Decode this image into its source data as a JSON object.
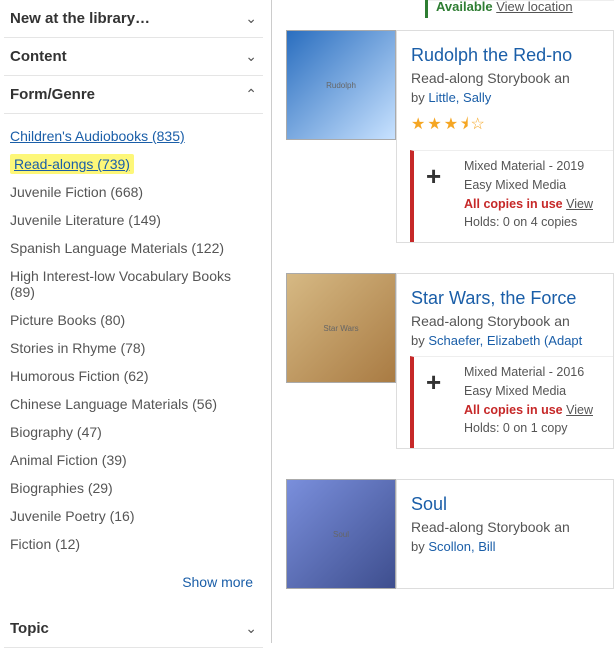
{
  "filters": [
    {
      "label": "New at the library…",
      "expanded": false
    },
    {
      "label": "Content",
      "expanded": false
    },
    {
      "label": "Form/Genre",
      "expanded": true
    },
    {
      "label": "Topic",
      "expanded": false
    }
  ],
  "formGenre": [
    {
      "label": "Children's Audiobooks (835)",
      "link": true,
      "hl": false
    },
    {
      "label": "Read-alongs (739)",
      "link": true,
      "hl": true
    },
    {
      "label": "Juvenile Fiction (668)",
      "link": false,
      "hl": false
    },
    {
      "label": "Juvenile Literature (149)",
      "link": false,
      "hl": false
    },
    {
      "label": "Spanish Language Materials (122)",
      "link": false,
      "hl": false
    },
    {
      "label": "High Interest-low Vocabulary Books (89)",
      "link": false,
      "hl": false
    },
    {
      "label": "Picture Books (80)",
      "link": false,
      "hl": false
    },
    {
      "label": "Stories in Rhyme (78)",
      "link": false,
      "hl": false
    },
    {
      "label": "Humorous Fiction (62)",
      "link": false,
      "hl": false
    },
    {
      "label": "Chinese Language Materials (56)",
      "link": false,
      "hl": false
    },
    {
      "label": "Biography (47)",
      "link": false,
      "hl": false
    },
    {
      "label": "Animal Fiction (39)",
      "link": false,
      "hl": false
    },
    {
      "label": "Biographies (29)",
      "link": false,
      "hl": false
    },
    {
      "label": "Juvenile Poetry (16)",
      "link": false,
      "hl": false
    },
    {
      "label": "Fiction (12)",
      "link": false,
      "hl": false
    }
  ],
  "showMore": "Show more",
  "topAvail": {
    "status": "Available",
    "loc": "View location"
  },
  "results": [
    {
      "title": "Rudolph the Red-no",
      "subtitle": "Read-along Storybook an",
      "byLabel": "by ",
      "author": "Little, Sally",
      "stars": "★★★⯨☆",
      "format": "Mixed Material - 2019",
      "media": "Easy Mixed Media",
      "status": "All copies in use",
      "view": "View",
      "holds": "Holds: 0 on 4 copies"
    },
    {
      "title": "Star Wars, the Force",
      "subtitle": "Read-along Storybook an",
      "byLabel": "by ",
      "author": "Schaefer, Elizabeth (Adapt",
      "format": "Mixed Material - 2016",
      "media": "Easy Mixed Media",
      "status": "All copies in use",
      "view": "View",
      "holds": "Holds: 0 on 1 copy"
    },
    {
      "title": "Soul",
      "subtitle": "Read-along Storybook an",
      "byLabel": "by ",
      "author": "Scollon, Bill"
    }
  ]
}
